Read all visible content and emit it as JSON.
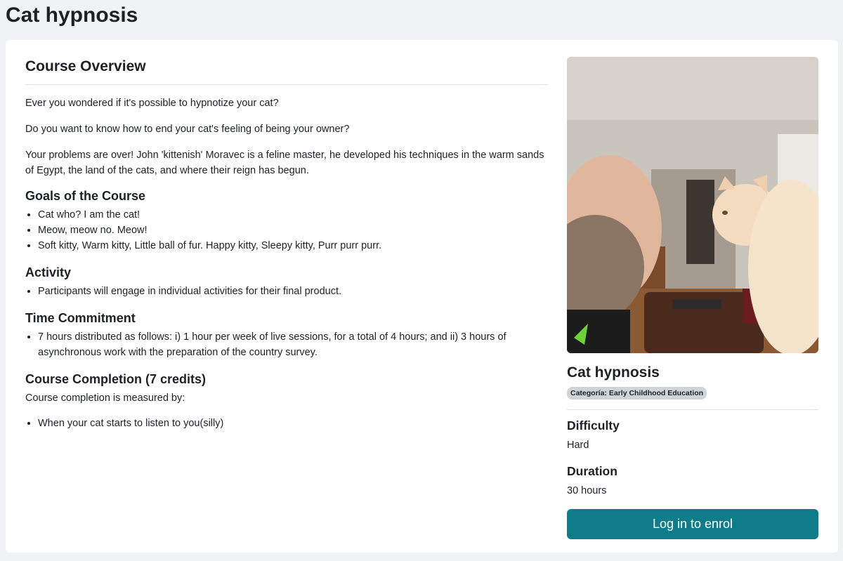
{
  "page": {
    "title": "Cat hypnosis"
  },
  "overview": {
    "title": "Course Overview",
    "paragraphs": [
      "Ever you wondered if it's possible to hypnotize your cat?",
      "Do you want to know how to end your cat's feeling of being your owner?",
      "Your problems are over! John 'kittenish' Moravec is a feline master, he developed his techniques in the warm sands of Egypt, the land of the cats, and where their reign has begun."
    ],
    "goals": {
      "title": "Goals of the Course",
      "items": [
        "Cat who? I am the cat!",
        "Meow, meow no. Meow!",
        "Soft kitty, Warm kitty, Little ball of fur. Happy kitty, Sleepy kitty, Purr purr purr."
      ]
    },
    "activity": {
      "title": "Activity",
      "items": [
        "Participants will engage in individual activities for their final product."
      ]
    },
    "time": {
      "title": "Time Commitment",
      "items": [
        "7 hours distributed as follows: i) 1 hour per week of live sessions, for a total of 4 hours; and ii) 3 hours of asynchronous work with the preparation of the country survey."
      ]
    },
    "completion": {
      "title": "Course Completion (7 credits)",
      "intro": "Course completion is measured by:",
      "items": [
        "When your cat starts to listen to you(silly)"
      ]
    }
  },
  "sidebar": {
    "course_name": "Cat hypnosis",
    "category_badge": "Categoría: Early Childhood Education",
    "difficulty_label": "Difficulty",
    "difficulty_value": "Hard",
    "duration_label": "Duration",
    "duration_value": "30 hours",
    "enrol_label": "Log in to enrol"
  },
  "colors": {
    "accent": "#0f7c8a",
    "background": "#f0f2f5",
    "badge": "#ced4da"
  }
}
